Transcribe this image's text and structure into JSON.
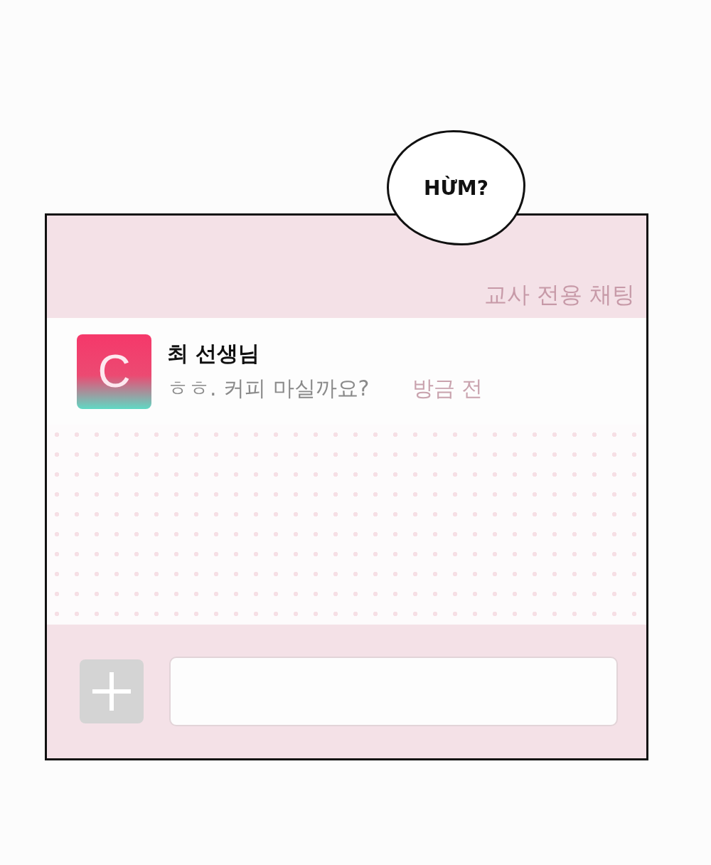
{
  "speech_bubble": {
    "text": "HỪM?"
  },
  "chat": {
    "title": "교사 전용 채팅",
    "messages": [
      {
        "avatar_letter": "C",
        "sender": "최 선생님",
        "text": "ㅎㅎ. 커피 마실까요?",
        "time": "방금 전"
      }
    ]
  }
}
